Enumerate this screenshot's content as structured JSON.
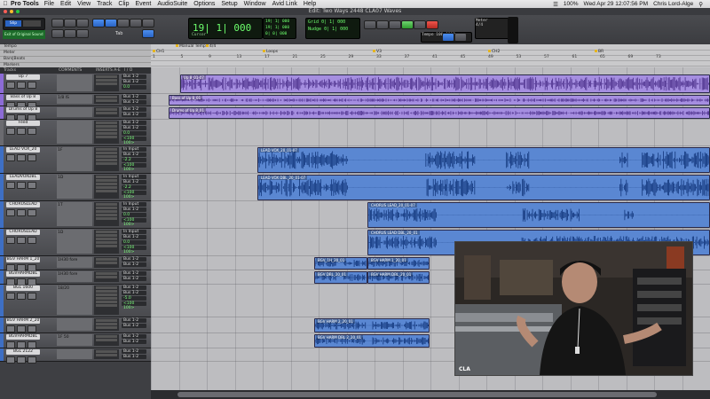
{
  "menubar": {
    "app_name": "Pro Tools",
    "items": [
      "File",
      "Edit",
      "View",
      "Track",
      "Clip",
      "Event",
      "AudioSuite",
      "Options",
      "Setup",
      "Window",
      "Avid Link",
      "Help"
    ],
    "status": {
      "battery": "100%",
      "datetime": "Wed Apr 29  12:07:56 PM",
      "user": "Chris Lord-Alge"
    }
  },
  "window_title": "Edit: Two Ways 2448 CLA07 Waves",
  "toolbar": {
    "mode_label": "Slip",
    "counter_main": "19| 1| 000",
    "counter_start": "19| 1| 000",
    "counter_end": "19| 1| 000",
    "counter_length": "0| 0| 000",
    "cursor_label": "Cursor",
    "grid_label": "Grid",
    "nudge_label": "Nudge",
    "grid_value": "0| 1| 000",
    "nudge_value": "0| 1| 000",
    "tempo_label": "Tempo",
    "tempo_value": "100.0000",
    "meter_label": "Meter",
    "meter_value": "4/4",
    "grid_left": "Grid",
    "fx_label": "Exit of Original Sound",
    "tool_label": "Tab"
  },
  "rulers": {
    "labels": [
      "Tempo",
      "Meter",
      "Bars|Beats",
      "Markers"
    ],
    "markers": [
      "Manual Tempo",
      "4/4",
      "CH1",
      "Loops",
      "V3",
      "CH2",
      "BR"
    ],
    "bars": [
      "1",
      "5",
      "9",
      "13",
      "17",
      "21",
      "25",
      "29",
      "33",
      "37",
      "41",
      "45",
      "49",
      "53",
      "57",
      "61",
      "65",
      "69",
      "73"
    ]
  },
  "column_headers": [
    "Tracks",
    "COMMENTS",
    "INSERTS A-E",
    "I / O"
  ],
  "tracks": [
    {
      "name": "Up 7",
      "comment": "",
      "in": "Bus 1-2",
      "out": "Bus 1-2",
      "vol": "0.0",
      "pan": "<100 100>",
      "color": "#8c6bd6"
    },
    {
      "name": "Bass of Up 8",
      "comment": "1/8 IS",
      "in": "Bus 1-2",
      "out": "Bus 1-2",
      "vol": "0.0",
      "pan": "<100 100>",
      "color": "#8c6bd6"
    },
    {
      "name": "Drums of Up 8",
      "comment": "",
      "in": "Bus 1-2",
      "out": "Bus 1-2",
      "vol": "0.0",
      "pan": "<100 100>",
      "color": "#8c6bd6"
    },
    {
      "name": "Feed",
      "comment": "",
      "in": "Bus 1-2",
      "out": "Bus 1-2",
      "vol": "0.0",
      "pan": "<100 100>",
      "color": "#6b6b70"
    },
    {
      "name": "LEAD VOX_20",
      "comment": "1F",
      "in": "In Input",
      "out": "Bus 1-2",
      "vol": "-2.2",
      "pan": "<100 100>",
      "color": "#3e6fc4"
    },
    {
      "name": "LEADVOXDBL",
      "comment": "1D",
      "in": "In Input",
      "out": "Bus 1-2",
      "vol": "-2.2",
      "pan": "<100 100>",
      "color": "#3e6fc4"
    },
    {
      "name": "CHORUSLEAD",
      "comment": "1T",
      "in": "In Input",
      "out": "Bus 1-2",
      "vol": "0.0",
      "pan": "<100 100>",
      "color": "#3e6fc4"
    },
    {
      "name": "CHORUSLEAD",
      "comment": "1D",
      "in": "In Input",
      "out": "Bus 1-2",
      "vol": "0.0",
      "pan": "<100 100>",
      "color": "#3e6fc4"
    },
    {
      "name": "BGV HARM 1_20",
      "comment": "1H30 fore",
      "in": "Bus 1-2",
      "out": "Bus 1-2",
      "vol": "-5.0",
      "pan": "<100 100>",
      "color": "#3e6fc4"
    },
    {
      "name": "BGVHARMDBL",
      "comment": "1H30 fore",
      "in": "Bus 1-2",
      "out": "Bus 1-2",
      "vol": "-5.0",
      "pan": "<100 100>",
      "color": "#3e6fc4"
    },
    {
      "name": "BGL 1600",
      "comment": "18/20",
      "in": "Bus 1-2",
      "out": "Bus 1-2",
      "vol": "-5.0",
      "pan": "<100 100>",
      "color": "#3e6fc4"
    },
    {
      "name": "BGV HARM 2_20",
      "comment": "",
      "in": "Bus 1-2",
      "out": "Bus 1-2",
      "vol": "-5.0",
      "pan": "<100 100>",
      "color": "#3e6fc4"
    },
    {
      "name": "BGVHARMDBL",
      "comment": "1F 50",
      "in": "Bus 1-2",
      "out": "Bus 1-2",
      "vol": "-5.0",
      "pan": "<100 100>",
      "color": "#3e6fc4"
    },
    {
      "name": "BGL 2122",
      "comment": "",
      "in": "Bus 1-2",
      "out": "Bus 1-2",
      "vol": "-5.0",
      "pan": "<100 100>",
      "color": "#3e6fc4"
    }
  ],
  "clips": {
    "up7": "Up 8_01-07",
    "bass": "Bass of Up 8_01",
    "drums": "Drums of Up 8_01",
    "leadvox": "LEAD VOX_20_01-07",
    "leadvoxdbl": "LEAD VOX DBL_20_01-07",
    "chorus1": "CHORUS LEAD_20_01-07",
    "chorus2": "CHORUS LEAD DBL_20_01",
    "bgv1a": "BGV_1H_20_01",
    "bgv1b": "BGV HARM 1_20_01",
    "bgv1c": "BGV DBL_20_01",
    "bgv1d": "BGV HARM DBL_20_01",
    "bgv2a": "BGV HARM 2_20_01",
    "bgv2b": "BGV HARM DBL 2_20_01"
  },
  "video": {
    "label": "CLA"
  },
  "colors": {
    "purple_clip": "#a58ee0",
    "blue_clip": "#5a87d2",
    "lcd_green": "#6dff6d",
    "grid_bg": "#bdbdc0"
  }
}
